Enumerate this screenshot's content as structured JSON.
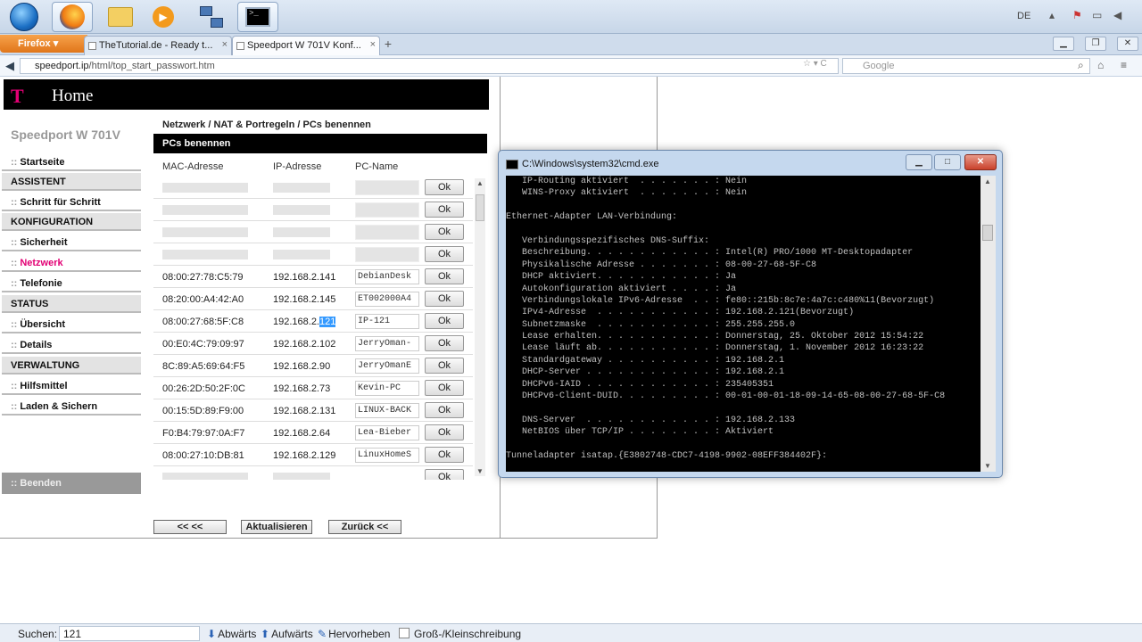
{
  "taskbar": {
    "language": "DE",
    "items": [
      "start",
      "firefox",
      "explorer",
      "media",
      "network",
      "cmd"
    ]
  },
  "browser": {
    "menu_label": "Firefox",
    "tabs": [
      {
        "label": "TheTutorial.de - Ready t..."
      },
      {
        "label": "Speedport W 701V Konf..."
      }
    ],
    "url_host": "speedport.ip",
    "url_path": "/html/top_start_passwort.htm",
    "search_placeholder": "Google"
  },
  "router": {
    "banner_logo": "T",
    "banner_title": "Home",
    "model": "Speedport W 701V",
    "breadcrumb": "Netzwerk / NAT & Portregeln / PCs benennen",
    "section_title": "PCs benennen",
    "columns": {
      "mac": "MAC-Adresse",
      "ip": "IP-Adresse",
      "pc": "PC-Name"
    },
    "menu": [
      {
        "label": "Startseite",
        "type": "item"
      },
      {
        "label": "ASSISTENT",
        "type": "cat"
      },
      {
        "label": "Schritt für Schritt",
        "type": "item"
      },
      {
        "label": "KONFIGURATION",
        "type": "cat"
      },
      {
        "label": "Sicherheit",
        "type": "item"
      },
      {
        "label": "Netzwerk",
        "type": "item"
      },
      {
        "label": "Telefonie",
        "type": "item"
      },
      {
        "label": "STATUS",
        "type": "cat"
      },
      {
        "label": "Übersicht",
        "type": "item"
      },
      {
        "label": "Details",
        "type": "item"
      },
      {
        "label": "VERWALTUNG",
        "type": "cat"
      },
      {
        "label": "Hilfsmittel",
        "type": "item"
      },
      {
        "label": "Laden & Sichern",
        "type": "item"
      }
    ],
    "menu_dots": "::",
    "logout": ":: Beenden",
    "ok_label": "Ok",
    "rows": [
      {
        "mac": "08:00:27:78:C5:79",
        "ip": "192.168.2.141",
        "pc": "DebianDesk"
      },
      {
        "mac": "08:20:00:A4:42:A0",
        "ip": "192.168.2.145",
        "pc": "ET002000A4"
      },
      {
        "mac": "08:00:27:68:5F:C8",
        "ip_prefix": "192.168.2.",
        "ip_hl": "121",
        "pc": "IP-121"
      },
      {
        "mac": "00:E0:4C:79:09:97",
        "ip": "192.168.2.102",
        "pc": "JerryOman-"
      },
      {
        "mac": "8C:89:A5:69:64:F5",
        "ip": "192.168.2.90",
        "pc": "JerryOmanE"
      },
      {
        "mac": "00:26:2D:50:2F:0C",
        "ip": "192.168.2.73",
        "pc": "Kevin-PC"
      },
      {
        "mac": "00:15:5D:89:F9:00",
        "ip": "192.168.2.131",
        "pc": "LINUX-BACK"
      },
      {
        "mac": "F0:B4:79:97:0A:F7",
        "ip": "192.168.2.64",
        "pc": "Lea-Bieber"
      },
      {
        "mac": "08:00:27:10:DB:81",
        "ip": "192.168.2.129",
        "pc": "LinuxHomeS"
      }
    ],
    "buttons": {
      "prev": "<<  <<",
      "refresh": "Aktualisieren",
      "back": "Zurück <<"
    }
  },
  "cmd": {
    "title": "C:\\Windows\\system32\\cmd.exe",
    "lines": [
      "   IP-Routing aktiviert  . . . . . . . : Nein",
      "   WINS-Proxy aktiviert  . . . . . . . : Nein",
      "",
      "Ethernet-Adapter LAN-Verbindung:",
      "",
      "   Verbindungsspezifisches DNS-Suffix:",
      "   Beschreibung. . . . . . . . . . . . : Intel(R) PRO/1000 MT-Desktopadapter",
      "   Physikalische Adresse . . . . . . . : 08-00-27-68-5F-C8",
      "   DHCP aktiviert. . . . . . . . . . . : Ja",
      "   Autokonfiguration aktiviert . . . . : Ja",
      "   Verbindungslokale IPv6-Adresse  . . : fe80::215b:8c7e:4a7c:c480%11(Bevorzugt)",
      "   IPv4-Adresse  . . . . . . . . . . . : 192.168.2.121(Bevorzugt)",
      "   Subnetzmaske  . . . . . . . . . . . : 255.255.255.0",
      "   Lease erhalten. . . . . . . . . . . : Donnerstag, 25. Oktober 2012 15:54:22",
      "   Lease läuft ab. . . . . . . . . . . : Donnerstag, 1. November 2012 16:23:22",
      "   Standardgateway . . . . . . . . . . : 192.168.2.1",
      "   DHCP-Server . . . . . . . . . . . . : 192.168.2.1",
      "   DHCPv6-IAID . . . . . . . . . . . . : 235405351",
      "   DHCPv6-Client-DUID. . . . . . . . . : 00-01-00-01-18-09-14-65-08-00-27-68-5F-C8",
      "",
      "   DNS-Server  . . . . . . . . . . . . : 192.168.2.133",
      "   NetBIOS über TCP/IP . . . . . . . . : Aktiviert",
      "",
      "Tunneladapter isatap.{E3802748-CDC7-4198-9902-08EFF384402F}:"
    ]
  },
  "findbar": {
    "label": "Suchen:",
    "value": "121",
    "down": "Abwärts",
    "up": "Aufwärts",
    "highlight": "Hervorheben",
    "case": "Groß-/Kleinschreibung"
  }
}
